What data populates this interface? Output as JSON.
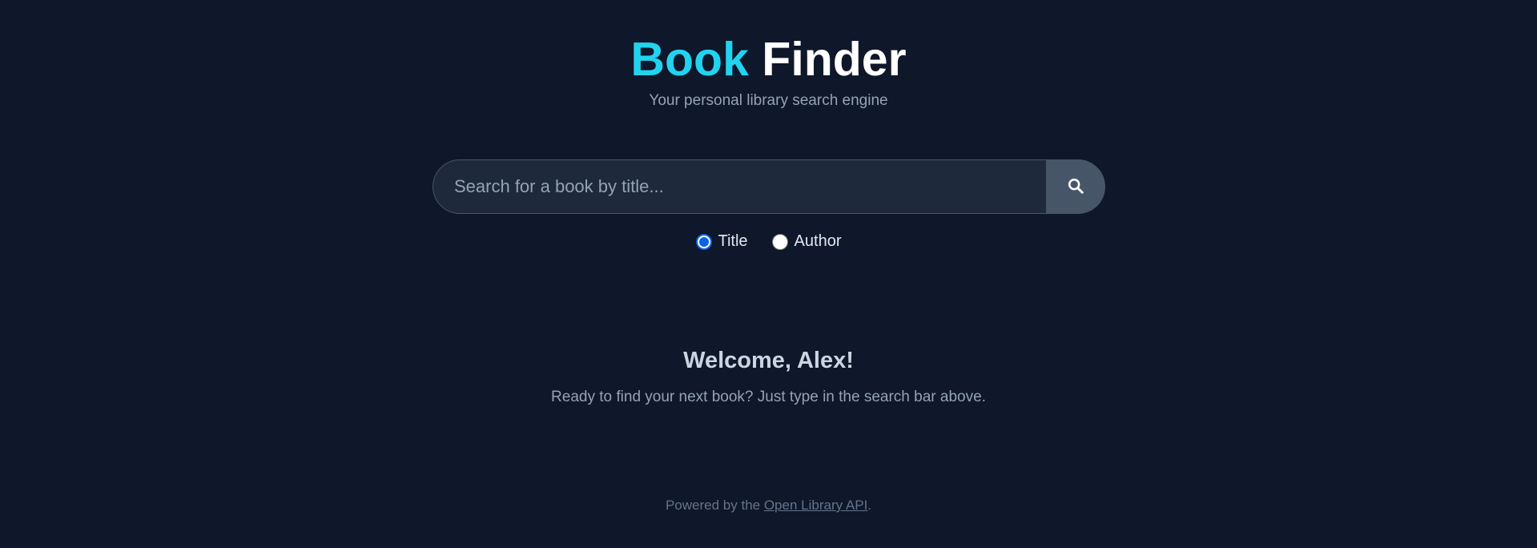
{
  "header": {
    "title_accent": "Book",
    "title_main": "Finder",
    "subtitle": "Your personal library search engine"
  },
  "search": {
    "placeholder": "Search for a book by title...",
    "value": "",
    "button_icon": "search-icon"
  },
  "search_mode": {
    "options": [
      {
        "label": "Title",
        "checked": true
      },
      {
        "label": "Author",
        "checked": false
      }
    ]
  },
  "welcome": {
    "heading": "Welcome, Alex!",
    "text": "Ready to find your next book? Just type in the search bar above."
  },
  "footer": {
    "prefix": "Powered by the ",
    "link_text": "Open Library API",
    "suffix": "."
  },
  "colors": {
    "background": "#0f172a",
    "accent": "#22d3ee",
    "input_bg": "#1e293b",
    "button_bg": "#475569",
    "radio_checked": "#0b63e5"
  }
}
